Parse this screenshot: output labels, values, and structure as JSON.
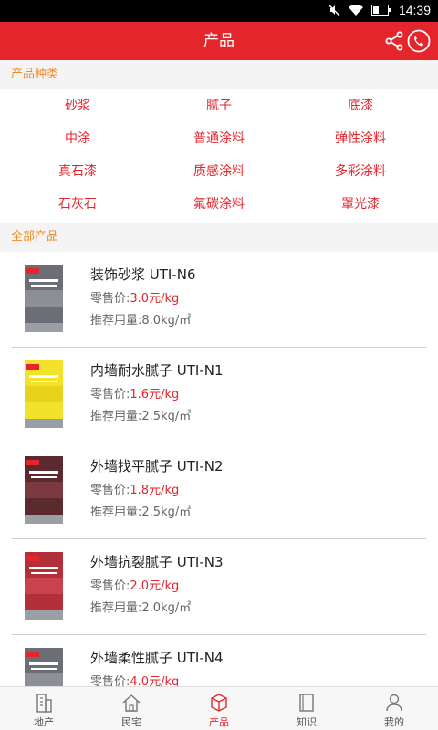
{
  "status_bar": {
    "time": "14:39"
  },
  "header": {
    "title": "产品"
  },
  "categories_section": {
    "title": "产品种类",
    "items": [
      "砂浆",
      "腻子",
      "底漆",
      "中涂",
      "普通涂料",
      "弹性涂料",
      "真石漆",
      "质感涂料",
      "多彩涂料",
      "石灰石",
      "氟碳涂料",
      "罩光漆"
    ]
  },
  "products_section": {
    "title": "全部产品",
    "price_label": "零售价:",
    "usage_label": "推荐用量:",
    "items": [
      {
        "name": "装饰砂浆 UTI-N6",
        "price": "3.0元/kg",
        "usage": "8.0kg/㎡",
        "thumb_color": "#6b6f75",
        "thumb_band": "#8c8f94"
      },
      {
        "name": "内墙耐水腻子 UTI-N1",
        "price": "1.6元/kg",
        "usage": "2.5kg/㎡",
        "thumb_color": "#f2e22a",
        "thumb_band": "#e9d31a"
      },
      {
        "name": "外墙找平腻子 UTI-N2",
        "price": "1.8元/kg",
        "usage": "2.5kg/㎡",
        "thumb_color": "#5a2a2e",
        "thumb_band": "#7a3a40"
      },
      {
        "name": "外墙抗裂腻子 UTI-N3",
        "price": "2.0元/kg",
        "usage": "2.0kg/㎡",
        "thumb_color": "#b2303a",
        "thumb_band": "#c8434c"
      },
      {
        "name": "外墙柔性腻子 UTI-N4",
        "price": "4.0元/kg",
        "usage": "",
        "thumb_color": "#6b6f75",
        "thumb_band": "#8c8f94"
      }
    ]
  },
  "tabs": [
    {
      "label": "地产",
      "icon": "building-icon"
    },
    {
      "label": "民宅",
      "icon": "house-icon"
    },
    {
      "label": "产品",
      "icon": "box-icon"
    },
    {
      "label": "知识",
      "icon": "book-icon"
    },
    {
      "label": "我的",
      "icon": "person-icon"
    }
  ],
  "colors": {
    "accent": "#e4262c",
    "section_title": "#f28c28"
  }
}
